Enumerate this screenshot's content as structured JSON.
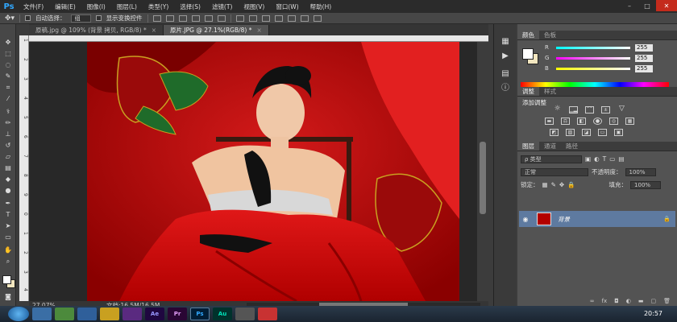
{
  "app": {
    "logo": "Ps",
    "menu": [
      "文件(F)",
      "编辑(E)",
      "图像(I)",
      "图层(L)",
      "类型(Y)",
      "选择(S)",
      "滤镜(T)",
      "视图(V)",
      "窗口(W)",
      "帮助(H)"
    ]
  },
  "options": {
    "auto_select_label": "自动选择：",
    "auto_select_value": "组",
    "show_transform_label": "显示变换控件"
  },
  "doc_tabs": [
    {
      "label": "原稿.jpg @ 109% (背景 拷贝, RGB/8) *",
      "close": "×"
    },
    {
      "label": "原片.JPG @ 27.1%(RGB/8) *",
      "close": "×"
    }
  ],
  "ruler_v": [
    "1",
    "2",
    "3",
    "4",
    "5",
    "6",
    "7",
    "8",
    "9",
    "0",
    "1",
    "2",
    "3",
    "4"
  ],
  "status": {
    "zoom": "27.07%",
    "doc_size": "文档:16.5M/16.5M"
  },
  "color_panel": {
    "tabs": [
      "颜色",
      "色板"
    ],
    "channels": [
      {
        "letter": "R",
        "value": "255",
        "color": "#ff4040"
      },
      {
        "letter": "G",
        "value": "255",
        "color": "#40ff40"
      },
      {
        "letter": "B",
        "value": "255",
        "color": "#4040ff"
      }
    ],
    "fg_color": "#ffffff",
    "bg_color": "#f2e6bf"
  },
  "adjust_panel": {
    "tabs": [
      "调整",
      "样式"
    ],
    "title": "添加调整"
  },
  "layers_panel": {
    "tabs": [
      "图层",
      "通道",
      "路径"
    ],
    "kind_label": "ρ 类型",
    "blend_mode": "正常",
    "opacity_label": "不透明度：",
    "opacity_value": "100%",
    "lock_label": "锁定：",
    "fill_label": "填充：",
    "fill_value": "100%",
    "layer_name": "背景",
    "layer_lock_icon": "lock-icon"
  },
  "taskbar": {
    "apps": [
      {
        "label": "Ae",
        "color": "#9999ff",
        "bg": "#1f0740"
      },
      {
        "label": "Pr",
        "color": "#e19cf5",
        "bg": "#2a0634"
      },
      {
        "label": "Ps",
        "color": "#31a8ff",
        "bg": "#001e36"
      },
      {
        "label": "Au",
        "color": "#00e4bb",
        "bg": "#00322c"
      }
    ],
    "clock": "20:57"
  }
}
